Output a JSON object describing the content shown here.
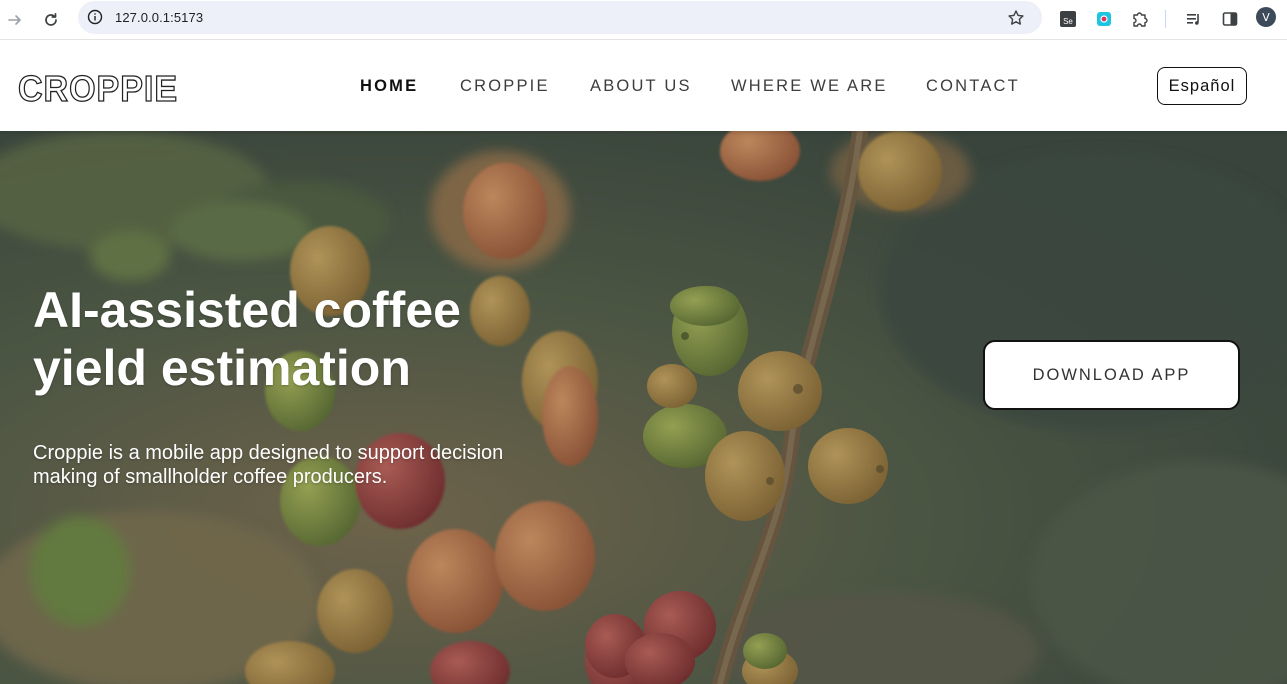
{
  "browser": {
    "url": "127.0.0.1:5173",
    "avatar_initial": "V",
    "extension_se_label": "Se"
  },
  "header": {
    "logo_text": "CROPPIE",
    "nav": [
      {
        "label": "HOME",
        "active": true
      },
      {
        "label": "CROPPIE",
        "active": false
      },
      {
        "label": "ABOUT US",
        "active": false
      },
      {
        "label": "WHERE WE ARE",
        "active": false
      },
      {
        "label": "CONTACT",
        "active": false
      }
    ],
    "language_button": "Español"
  },
  "hero": {
    "title_line1": "AI-assisted coffee",
    "title_line2": "yield estimation",
    "subtitle_line1": "Croppie is a mobile app designed to support decision",
    "subtitle_line2": "making of smallholder coffee producers.",
    "cta_label": "DOWNLOAD APP"
  },
  "colors": {
    "accent": "#111111",
    "hero_overlay": "#3c423c"
  },
  "icons": [
    "forward-arrow-icon",
    "reload-icon",
    "info-icon",
    "star-icon",
    "selenium-extension-icon",
    "record-extension-icon",
    "puzzle-icon",
    "media-control-icon",
    "side-panel-icon"
  ]
}
